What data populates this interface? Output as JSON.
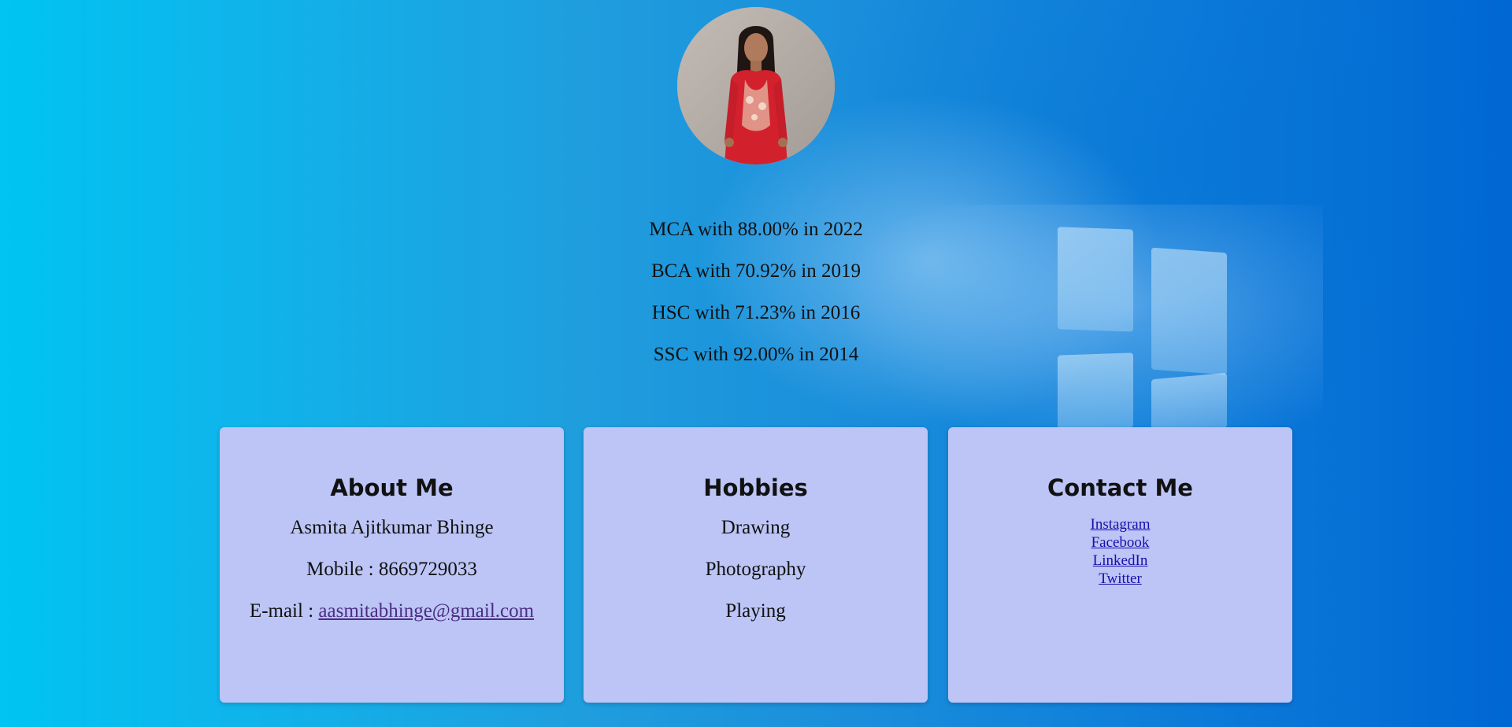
{
  "profile": {
    "photo_alt": "Profile photo"
  },
  "education": [
    "MCA with 88.00% in 2022",
    "BCA with 70.92% in 2019",
    "HSC with 71.23% in 2016",
    "SSC with 92.00% in 2014"
  ],
  "about": {
    "title": "About Me",
    "name": "Asmita Ajitkumar Bhinge",
    "mobile": "Mobile : 8669729033",
    "email_label": "E-mail : ",
    "email": "aasmitabhinge@gmail.com"
  },
  "hobbies": {
    "title": "Hobbies",
    "items": [
      "Drawing",
      "Photography",
      "Playing"
    ]
  },
  "contact": {
    "title": "Contact Me",
    "links": [
      "Instagram",
      "Facebook",
      "LinkedIn",
      "Twitter"
    ]
  },
  "colors": {
    "card_bg": "#bcc5f6",
    "link": "#1a0dab",
    "visited_link": "#4b2d83",
    "background_left": "#00c4f2",
    "background_right": "#0067d3"
  }
}
